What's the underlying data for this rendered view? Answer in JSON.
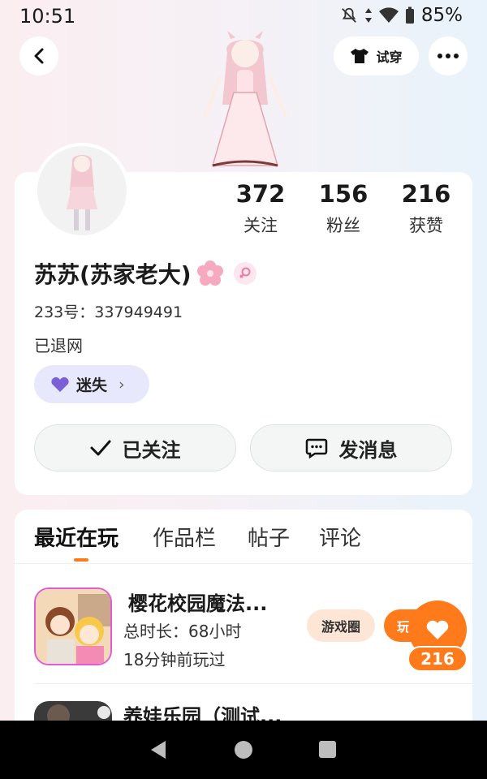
{
  "status_bar": {
    "time": "10:51",
    "battery": "85%"
  },
  "header": {
    "try_on_label": "试穿"
  },
  "profile": {
    "stats": [
      {
        "value": "372",
        "label": "关注"
      },
      {
        "value": "156",
        "label": "粉丝"
      },
      {
        "value": "216",
        "label": "获赞"
      }
    ],
    "name": "苏苏(苏家老大)",
    "uid": "233号：337949491",
    "bio": "已退网",
    "tag_label": "迷失",
    "follow_label": "已关注",
    "message_label": "发消息"
  },
  "tabs": [
    {
      "label": "最近在玩"
    },
    {
      "label": "作品栏"
    },
    {
      "label": "帖子"
    },
    {
      "label": "评论"
    }
  ],
  "games": [
    {
      "title": "樱花校园魔法...",
      "total_time": "总时长：68小时",
      "last_played": "18分钟前玩过",
      "circle_label": "游戏圈",
      "play_label": "玩"
    },
    {
      "title": "养娃乐园（测试..."
    }
  ],
  "like_count": "216",
  "colors": {
    "accent": "#ff7a1a",
    "tag_bg": "#e8e8fc",
    "circle_bg": "#fde6d6"
  }
}
